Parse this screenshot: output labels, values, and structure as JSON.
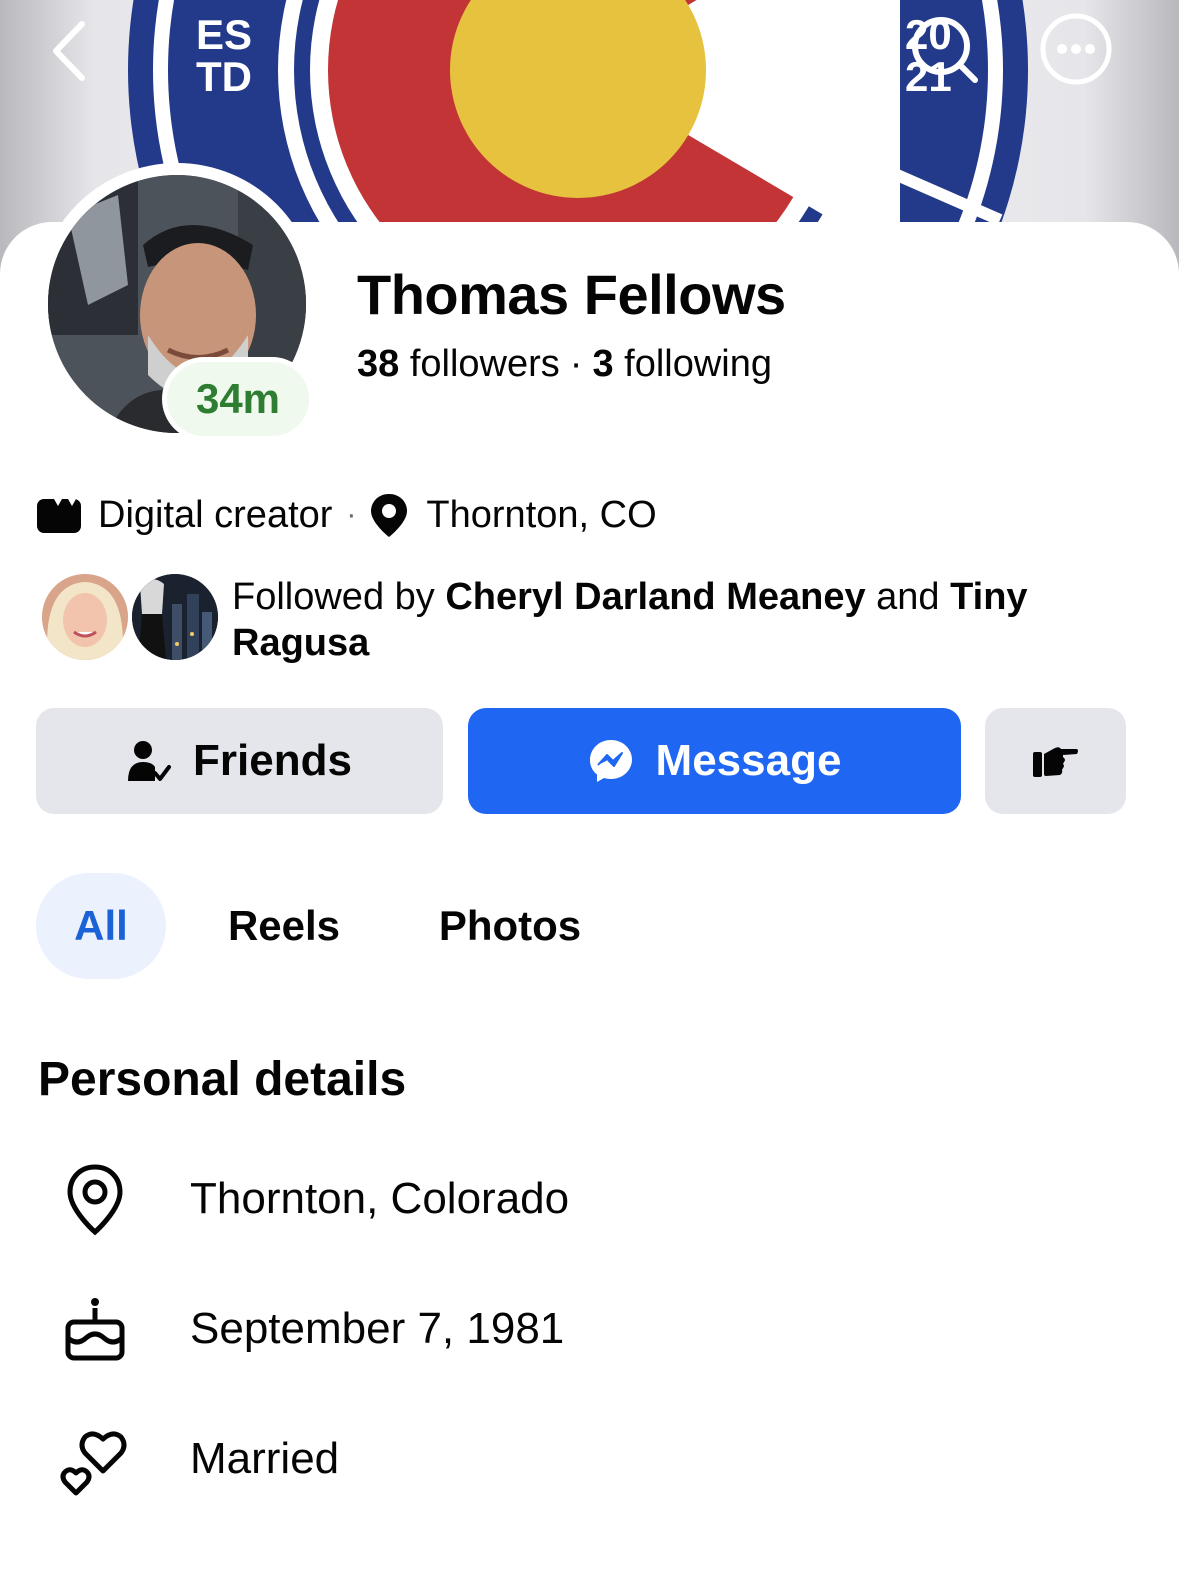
{
  "cover": {
    "badge_left": "ES TD",
    "badge_right": "20 21",
    "colors": {
      "blue": "#233a8a",
      "red": "#c23436",
      "gold": "#e6c23e"
    }
  },
  "header_icons": {
    "back": "chevron-left-icon",
    "search": "search-icon",
    "more": "more-options-icon"
  },
  "profile": {
    "name": "Thomas Fellows",
    "status_badge": "34m",
    "followers_count": "38",
    "followers_label": "followers",
    "separator": "·",
    "following_count": "3",
    "following_label": "following"
  },
  "intro": {
    "category": "Digital creator",
    "separator": "·",
    "location": "Thornton, CO"
  },
  "mutual": {
    "prefix": "Followed by",
    "name_1": "Cheryl Darland Meaney",
    "conjunction": "and",
    "name_2": "Tiny Ragusa"
  },
  "actions": {
    "friends_label": "Friends",
    "message_label": "Message",
    "poke_icon": "poke-hand-icon"
  },
  "tabs": [
    {
      "label": "All",
      "active": true
    },
    {
      "label": "Reels",
      "active": false
    },
    {
      "label": "Photos",
      "active": false
    }
  ],
  "personal_details": {
    "title": "Personal details",
    "items": [
      {
        "icon": "location-pin-icon",
        "text": "Thornton, Colorado"
      },
      {
        "icon": "birthday-cake-icon",
        "text": "September 7, 1981"
      },
      {
        "icon": "hearts-icon",
        "text": "Married"
      }
    ]
  },
  "colors": {
    "accent_blue": "#1f66f2",
    "tab_active_bg": "#ebf2fe",
    "tab_active_text": "#1b62d6",
    "button_gray": "#e4e6eb",
    "badge_green": "#2e7d32"
  }
}
